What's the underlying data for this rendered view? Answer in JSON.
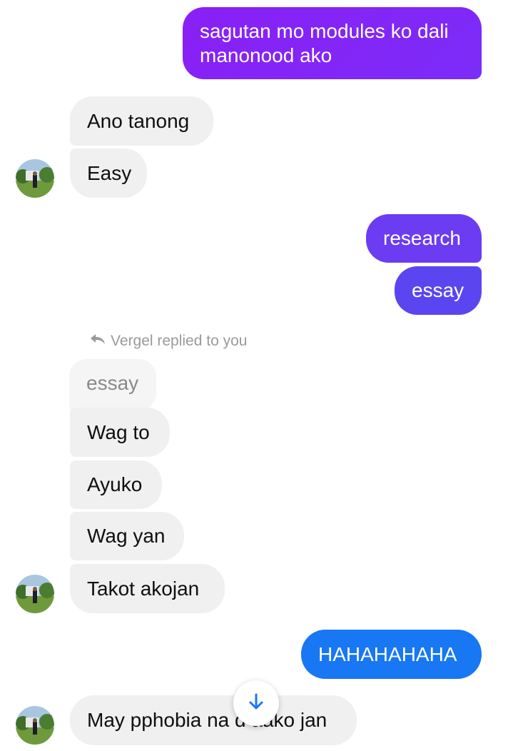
{
  "messages": {
    "m1": "sagutan mo modules ko dali\nmanonood ako",
    "m2": "Ano tanong",
    "m3": "Easy",
    "m4": "research",
    "m5": "essay",
    "reply_label": "Vergel replied to you",
    "reply_quote": "essay",
    "m6": "Wag to",
    "m7": "Ayuko",
    "m8": "Wag yan",
    "m9": "Takot akojan",
    "m10": "HAHAHAHAHA",
    "m11": "May pphobia na d aako jan"
  },
  "icons": {
    "reply": "reply-arrow-icon",
    "scroll_down": "arrow-down-icon",
    "avatar": "contact-avatar"
  },
  "colors": {
    "incoming_bubble": "#f0f0f0",
    "outgoing_purple": "#8a1ff5",
    "outgoing_violet": "#6b3cf2",
    "outgoing_blue": "#1877f2",
    "accent": "#1877f2"
  }
}
